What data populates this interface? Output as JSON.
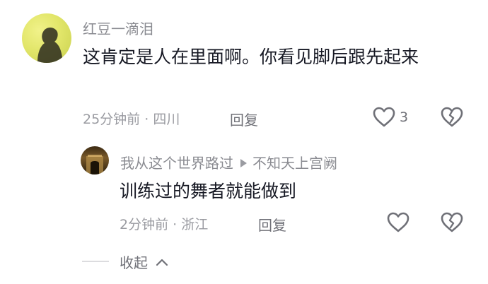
{
  "comment": {
    "username": "红豆一滴泪",
    "text": "这肯定是人在里面啊。你看见脚后跟先起来",
    "time": "25分钟前",
    "location": "四川",
    "reply_label": "回复",
    "like_count": "3"
  },
  "reply": {
    "username": "我从这个世界路过",
    "reply_to": "不知天上宫阙",
    "text": "训练过的舞者就能做到",
    "time": "2分钟前",
    "location": "浙江",
    "reply_label": "回复"
  },
  "collapse": {
    "label": "收起"
  },
  "icons": {
    "like": "heart-outline-icon",
    "dislike": "broken-heart-icon",
    "collapse": "chevron-up-icon"
  },
  "colors": {
    "text_primary": "#161823",
    "text_secondary": "#8a8b91",
    "icon": "#6f7077"
  }
}
